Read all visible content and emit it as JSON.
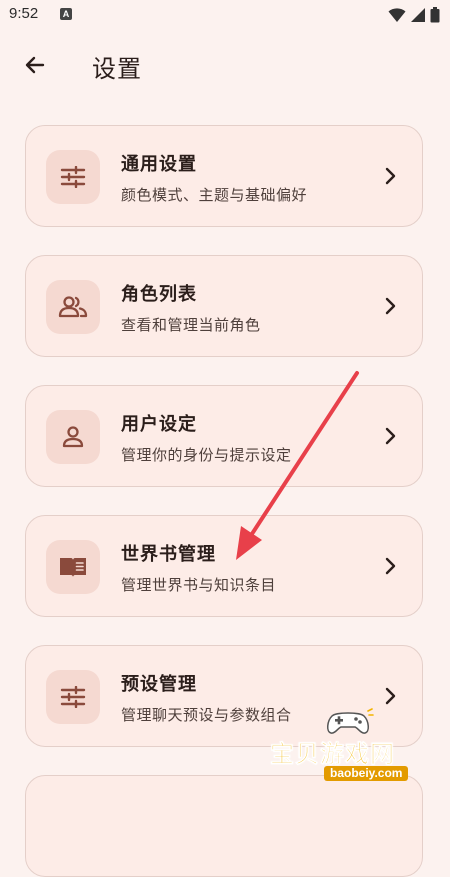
{
  "status_bar": {
    "time": "9:52",
    "app_badge": "A",
    "icons": [
      "wifi-icon",
      "signal-icon",
      "battery-icon"
    ]
  },
  "header": {
    "title": "设置",
    "back_icon": "arrow-left-icon"
  },
  "settings": {
    "items": [
      {
        "title": "通用设置",
        "subtitle": "颜色模式、主题与基础偏好",
        "icon": "sliders-icon"
      },
      {
        "title": "角色列表",
        "subtitle": "查看和管理当前角色",
        "icon": "people-icon"
      },
      {
        "title": "用户设定",
        "subtitle": "管理你的身份与提示设定",
        "icon": "person-icon"
      },
      {
        "title": "世界书管理",
        "subtitle": "管理世界书与知识条目",
        "icon": "book-icon"
      },
      {
        "title": "预设管理",
        "subtitle": "管理聊天预设与参数组合",
        "icon": "sliders-icon"
      }
    ]
  },
  "watermark": {
    "text": "宝贝游戏网",
    "url": "baobeiy.com"
  },
  "colors": {
    "background": "#fcf2ef",
    "card": "#fdece7",
    "icon_box": "#f5d9d1",
    "icon": "#8a4a3c",
    "arrow": "#e8404a"
  }
}
